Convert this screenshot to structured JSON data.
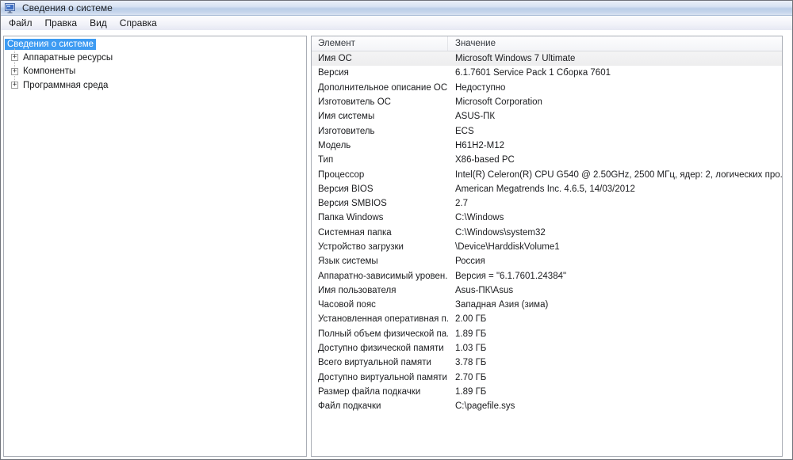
{
  "window": {
    "title": "Сведения о системе"
  },
  "menu": {
    "items": [
      "Файл",
      "Правка",
      "Вид",
      "Справка"
    ]
  },
  "tree": {
    "root": "Сведения о системе",
    "selected": "Сведения о системе",
    "expander_glyph": "+",
    "children": [
      "Аппаратные ресурсы",
      "Компоненты",
      "Программная среда"
    ]
  },
  "list": {
    "columns": [
      "Элемент",
      "Значение"
    ],
    "rows": [
      {
        "item": "Имя ОС",
        "value": "Microsoft Windows 7 Ultimate"
      },
      {
        "item": "Версия",
        "value": "6.1.7601 Service Pack 1 Сборка 7601"
      },
      {
        "item": "Дополнительное описание ОС",
        "value": "Недоступно"
      },
      {
        "item": "Изготовитель ОС",
        "value": "Microsoft Corporation"
      },
      {
        "item": "Имя системы",
        "value": "ASUS-ПК"
      },
      {
        "item": "Изготовитель",
        "value": "ECS"
      },
      {
        "item": "Модель",
        "value": "H61H2-M12"
      },
      {
        "item": "Тип",
        "value": "X86-based PC"
      },
      {
        "item": "Процессор",
        "value": "Intel(R) Celeron(R) CPU G540 @ 2.50GHz, 2500 МГц, ядер: 2, логических про..."
      },
      {
        "item": "Версия BIOS",
        "value": "American Megatrends Inc. 4.6.5, 14/03/2012"
      },
      {
        "item": "Версия SMBIOS",
        "value": "2.7"
      },
      {
        "item": "Папка Windows",
        "value": "C:\\Windows"
      },
      {
        "item": "Системная папка",
        "value": "C:\\Windows\\system32"
      },
      {
        "item": "Устройство загрузки",
        "value": "\\Device\\HarddiskVolume1"
      },
      {
        "item": "Язык системы",
        "value": "Россия"
      },
      {
        "item": "Аппаратно-зависимый уровен...",
        "value": "Версия = \"6.1.7601.24384\""
      },
      {
        "item": "Имя пользователя",
        "value": "Asus-ПК\\Asus"
      },
      {
        "item": "Часовой пояс",
        "value": "Западная Азия (зима)"
      },
      {
        "item": "Установленная оперативная п...",
        "value": "2.00 ГБ"
      },
      {
        "item": "Полный объем физической па...",
        "value": "1.89 ГБ"
      },
      {
        "item": "Доступно физической памяти",
        "value": "1.03 ГБ"
      },
      {
        "item": "Всего виртуальной памяти",
        "value": "3.78 ГБ"
      },
      {
        "item": "Доступно виртуальной памяти",
        "value": "2.70 ГБ"
      },
      {
        "item": "Размер файла подкачки",
        "value": "1.89 ГБ"
      },
      {
        "item": "Файл подкачки",
        "value": "C:\\pagefile.sys"
      }
    ]
  },
  "colors": {
    "tree_selection": "#3d9bf2",
    "titlebar_top": "#e9eff9",
    "titlebar_bottom": "#bbcee8",
    "selected_row": "#f1f1f2",
    "pane_border": "#aaaeb6"
  }
}
